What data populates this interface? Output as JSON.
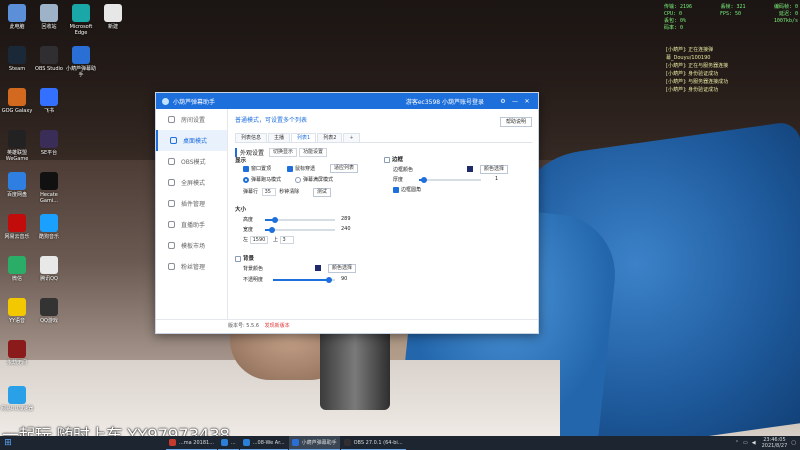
{
  "desktop": {
    "icons": [
      {
        "label": "此电脑",
        "color": "#5b8fd8"
      },
      {
        "label": "回收站",
        "color": "#9fb3c8"
      },
      {
        "label": "Microsoft Edge",
        "color": "#1aa7a8"
      },
      {
        "label": "新建",
        "color": "#e7e7e7"
      },
      {
        "label": "Steam",
        "color": "#1b2838"
      },
      {
        "label": "OBS Studio",
        "color": "#302e31"
      },
      {
        "label": "小葫芦弹幕助手",
        "color": "#2a6fd6"
      },
      {
        "label": "GOG Galaxy",
        "color": "#d2691e"
      },
      {
        "label": "飞书",
        "color": "#3370ff"
      },
      {
        "label": "英雄联盟WeGame",
        "color": "#222"
      },
      {
        "label": "SE平台",
        "color": "#3a2d57"
      },
      {
        "label": "百度网盘",
        "color": "#2f7fe3"
      },
      {
        "label": "Hecate Gami...",
        "color": "#111"
      },
      {
        "label": "网易云音乐",
        "color": "#c20c0c"
      },
      {
        "label": "酷狗音乐",
        "color": "#1aa0ff"
      },
      {
        "label": "微信",
        "color": "#2aae67"
      },
      {
        "label": "腾讯QQ",
        "color": "#e8e8e8"
      },
      {
        "label": "YY语音",
        "color": "#f4c800"
      },
      {
        "label": "QQ游戏",
        "color": "#333"
      },
      {
        "label": "永劫无间",
        "color": "#8b1a1a"
      },
      {
        "label": "网易UU加速器",
        "color": "#2aa0e8"
      }
    ]
  },
  "overlay": {
    "stats": [
      [
        "传输: 2196",
        "丢帧: 321",
        "编码帧: 0"
      ],
      [
        "CPU: 0",
        "FPS: 50",
        "延迟: 0"
      ],
      [
        "丢包: 0%",
        "",
        "1007kb/s"
      ],
      [
        "码率: 0",
        "",
        ""
      ]
    ],
    "logs": [
      "[小葫芦]: 正在连接弹",
      "幕_Douyu/100190",
      "[小葫芦]: 正在与服务器连接",
      "[小葫芦]: 身份验证成功",
      "[小葫芦]: 与服务器连接成功",
      "[小葫芦]: 身份验证成功"
    ]
  },
  "window": {
    "title": "小葫芦弹幕助手",
    "account": "游客ec3598  小葫芦账号登录",
    "nav": [
      {
        "label": "房间设置",
        "active": false
      },
      {
        "label": "桌面模式",
        "active": true
      },
      {
        "label": "OBS模式",
        "active": false
      },
      {
        "label": "全屏模式",
        "active": false
      },
      {
        "label": "插件管理",
        "active": false
      },
      {
        "label": "直播助手",
        "active": false
      },
      {
        "label": "模板市场",
        "active": false
      },
      {
        "label": "粉丝管理",
        "active": false
      }
    ],
    "mode_text": "普通模式，可设置多个列表",
    "help_button": "帮助说明",
    "tabs": [
      {
        "label": "列表信息",
        "active": false
      },
      {
        "label": "主播",
        "active": false
      },
      {
        "label": "列表1",
        "active": true
      },
      {
        "label": "列表2",
        "active": false
      },
      {
        "label": "+",
        "active": false
      }
    ],
    "section_title": "外观设置",
    "chips": [
      "切换显示",
      "功能设置"
    ],
    "display": {
      "title": "显示",
      "cb_window": "窗口置顶",
      "cb_lock": "鼠标穿透",
      "btn_reset": "适应列表",
      "radio_a": "弹幕跑马模式",
      "radio_b": "弹幕满屏模式",
      "speed_label": "弹幕行",
      "speed_value": "35",
      "speed_unit": "秒钟清除",
      "btn_test": "测试"
    },
    "size": {
      "title": "大小",
      "height_label": "高度",
      "height_value": "289",
      "height_fraction": 0.14,
      "width_label": "宽度",
      "width_value": "240",
      "width_fraction": 0.1,
      "left_label": "左",
      "left_value": "1590",
      "top_label": "上",
      "top_value": "3"
    },
    "background": {
      "title": "背景",
      "color_label": "背景颜色",
      "color_btn": "颜色选择",
      "opacity_label": "不透明度",
      "opacity_value": "90",
      "opacity_fraction": 0.9,
      "swatch_color": "#1f2a6b"
    },
    "border": {
      "title": "边框",
      "color_label": "边框颜色",
      "color_btn": "颜色选择",
      "thickness_label": "厚度",
      "thickness_value": "1",
      "thickness_fraction": 0.08,
      "rounded_label": "边框圆角",
      "swatch_color": "#1f2a6b"
    },
    "status": {
      "version": "版本号: 5.5.6",
      "update": "发现新版本"
    },
    "colors": {
      "accent": "#1d6fdc"
    }
  },
  "taskbar": {
    "items": [
      {
        "label": "...ma 20181...",
        "color": "#c73b2e",
        "on": false
      },
      {
        "label": "...",
        "color": "#2b7fd6",
        "on": false
      },
      {
        "label": "...08-We Ar...",
        "color": "#2b7fd6",
        "on": false
      },
      {
        "label": "小葫芦弹幕助手",
        "color": "#2a6fd6",
        "on": true
      },
      {
        "label": "OBS 27.0.1 (64-bi...",
        "color": "#302e31",
        "on": false
      }
    ],
    "time": "23:46:05",
    "date": "2021/8/27"
  },
  "watermark": "一起玩 随时上车 YY97973438"
}
